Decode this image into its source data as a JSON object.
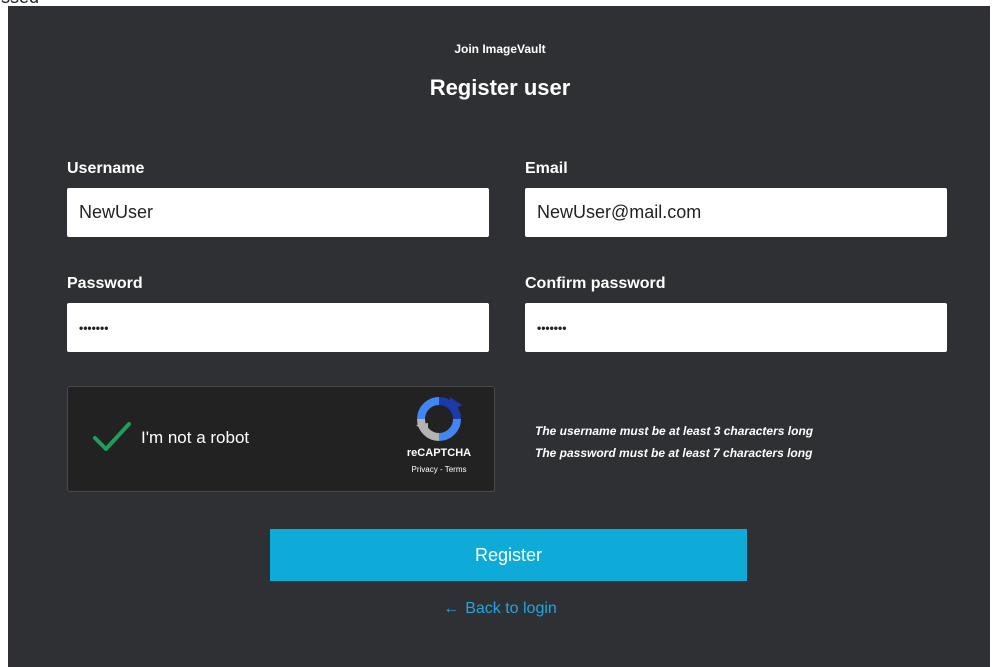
{
  "top_fragment": "ssed",
  "header": {
    "subtitle": "Join ImageVault",
    "title": "Register user"
  },
  "form": {
    "username": {
      "label": "Username",
      "value": "NewUser"
    },
    "email": {
      "label": "Email",
      "value": "NewUser@mail.com"
    },
    "password": {
      "label": "Password",
      "value": "•••••••"
    },
    "confirm_password": {
      "label": "Confirm password",
      "value": "•••••••"
    }
  },
  "captcha": {
    "label": "I'm not a robot",
    "brand": "reCAPTCHA",
    "links": "Privacy - Terms",
    "checked": true,
    "check_color": "#1e9e5a"
  },
  "hints": [
    "The username must be at least 3 characters long",
    "The password must be at least 7 characters long"
  ],
  "actions": {
    "register_label": "Register",
    "back_label": "Back to login",
    "back_icon": "arrow-left-icon"
  },
  "colors": {
    "panel_bg": "#2f3033",
    "accent": "#0eaad8",
    "link": "#1ea7e0"
  }
}
